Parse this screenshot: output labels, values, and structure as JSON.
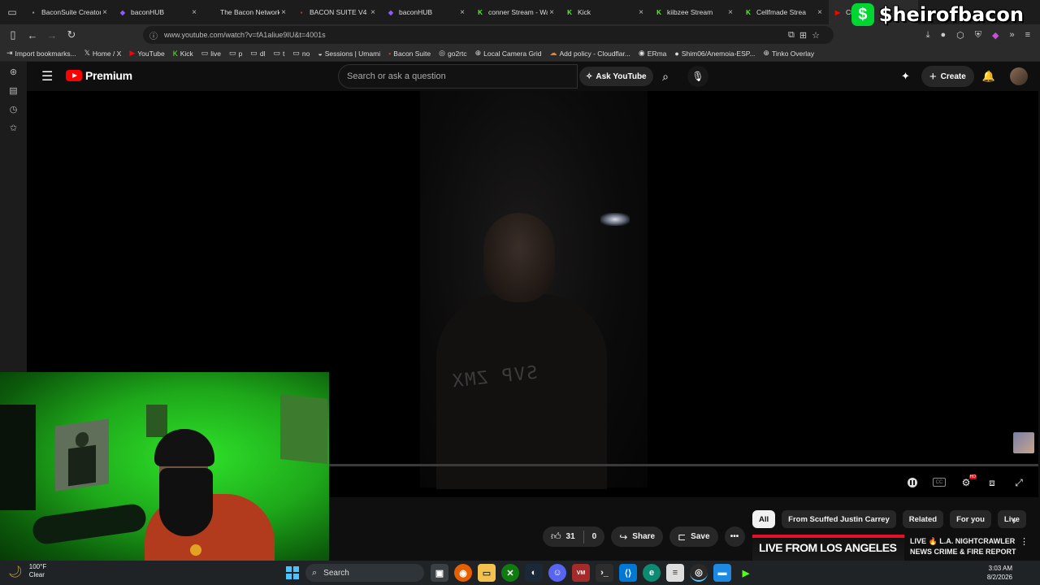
{
  "browser": {
    "tabs": [
      {
        "title": "BaconSuite Creator Dash",
        "icon": "bacon-icon",
        "color": "#999999"
      },
      {
        "title": "baconHUB",
        "icon": "hub-icon",
        "color": "#8b5cf6"
      },
      {
        "title": "The Bacon Network",
        "icon": "none",
        "color": "#cccccc"
      },
      {
        "title": "BACON SUITE V4 //",
        "icon": "bacon-icon",
        "color": "#c0392b"
      },
      {
        "title": "baconHUB",
        "icon": "hub-icon",
        "color": "#8b5cf6"
      },
      {
        "title": "conner Stream - Wa",
        "icon": "kick-icon",
        "color": "#53fc18"
      },
      {
        "title": "Kick",
        "icon": "kick-icon",
        "color": "#53fc18"
      },
      {
        "title": "kiibzee Stream",
        "icon": "kick-icon",
        "color": "#53fc18"
      },
      {
        "title": "Cellfmade Strea",
        "icon": "kick-icon",
        "color": "#53fc18"
      },
      {
        "title": "Chill",
        "icon": "youtube-icon",
        "color": "#ff0000",
        "active": true
      }
    ],
    "url": "www.youtube.com/watch?v=fA1aliue9IU&t=4001s",
    "bookmarks": [
      {
        "label": "Import bookmarks...",
        "icon": "import-icon"
      },
      {
        "label": "Home / X",
        "icon": "x-icon"
      },
      {
        "label": "YouTube",
        "icon": "youtube-icon"
      },
      {
        "label": "Kick",
        "icon": "kick-icon"
      },
      {
        "label": "live",
        "icon": "folder-icon"
      },
      {
        "label": "p",
        "icon": "folder-icon"
      },
      {
        "label": "dl",
        "icon": "folder-icon"
      },
      {
        "label": "t",
        "icon": "folder-icon"
      },
      {
        "label": "no",
        "icon": "folder-icon"
      },
      {
        "label": "Sessions | Umami",
        "icon": "umami-icon"
      },
      {
        "label": "Bacon Suite",
        "icon": "bacon-icon"
      },
      {
        "label": "go2rtc",
        "icon": "go2rtc-icon"
      },
      {
        "label": "Local Camera Grid",
        "icon": "globe-icon"
      },
      {
        "label": "Add policy - Cloudflar...",
        "icon": "cloudflare-icon"
      },
      {
        "label": "ERma",
        "icon": "ytm-icon"
      },
      {
        "label": "Shim06/Anemoia-ESP...",
        "icon": "github-icon"
      },
      {
        "label": "Tinko Overlay",
        "icon": "globe-icon"
      }
    ]
  },
  "overlay": {
    "brand_symbol": "$",
    "brand_name": "$heirofbacon"
  },
  "youtube": {
    "logo_text": "Premium",
    "search_placeholder": "Search or ask a question",
    "ask_label": "Ask YouTube",
    "create_label": "Create"
  },
  "video": {
    "shirt_text": "SVP ZMX",
    "likes": "31",
    "dislikes": "0",
    "share_label": "Share",
    "save_label": "Save"
  },
  "chips": [
    "All",
    "From Scuffed Justin Carrey",
    "Related",
    "For you",
    "Live"
  ],
  "recommendation": {
    "thumb_text": "LIVE FROM LOS ANGELES",
    "title": "LIVE 🔥 L.A. NIGHTCRAWLER NEWS CRIME & FIRE REPORT ..."
  },
  "taskbar": {
    "temp": "100°F",
    "condition": "Clear",
    "search_label": "Search",
    "time": "3:03 AM",
    "date": "8/2/2026"
  },
  "colors": {
    "accent": "#ff0000",
    "kick": "#53fc18",
    "cashapp": "#00d632",
    "webcam_green": "#2fe12a"
  }
}
